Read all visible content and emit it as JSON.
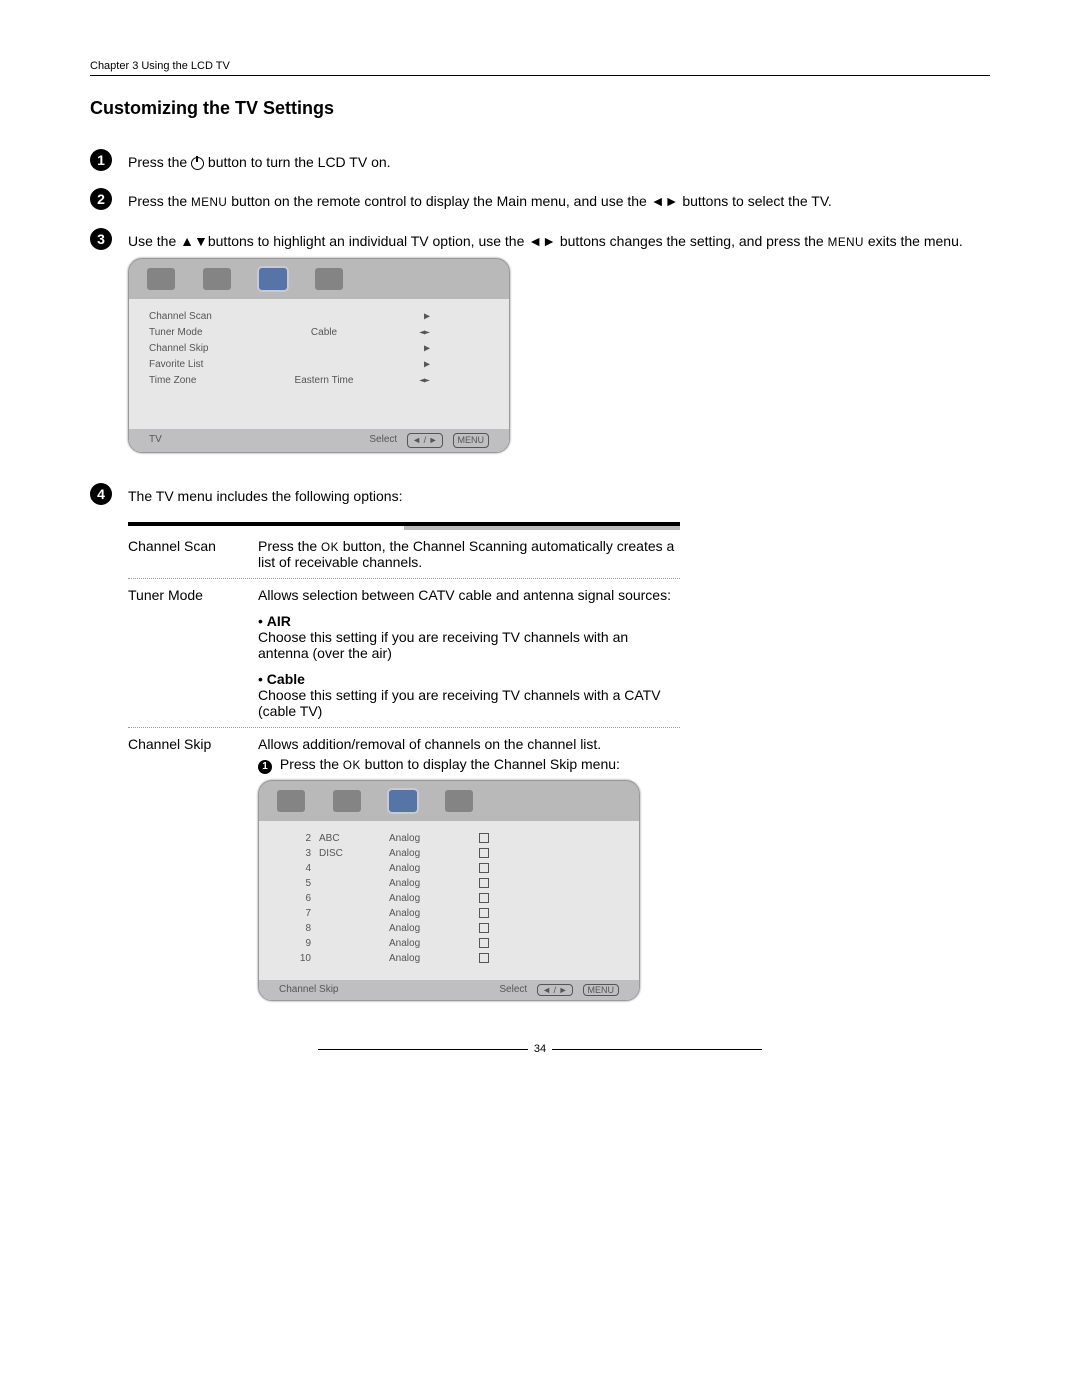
{
  "chapter": "Chapter 3 Using the LCD TV",
  "title": "Customizing the TV Settings",
  "steps": {
    "s1": {
      "n": "1",
      "pre": "Press the ",
      "post": " button to turn the LCD TV on."
    },
    "s2": {
      "n": "2",
      "a": "Press the ",
      "menu": "MENU",
      "b": " button on the remote control to display the Main menu, and use the ◄► buttons to select the TV."
    },
    "s3": {
      "n": "3",
      "a": "Use the ▲▼buttons to highlight an individual TV option, use the ◄► buttons changes the setting, and press the ",
      "menu": "MENU",
      "b": " exits the menu."
    },
    "s4": {
      "n": "4",
      "text": "The TV menu includes the following options:"
    }
  },
  "tv_menu": {
    "rows": [
      {
        "label": "Channel Scan",
        "value": "",
        "arr": "▶"
      },
      {
        "label": "Tuner Mode",
        "value": "Cable",
        "arr": "◄►"
      },
      {
        "label": "Channel Skip",
        "value": "",
        "arr": "▶"
      },
      {
        "label": "Favorite List",
        "value": "",
        "arr": "▶"
      },
      {
        "label": "Time Zone",
        "value": "Eastern Time",
        "arr": "◄►"
      }
    ],
    "foot_left": "TV",
    "foot_select": "Select",
    "foot_menu": "MENU"
  },
  "options": {
    "channel_scan": {
      "name": "Channel Scan",
      "desc_a": "Press the ",
      "ok": "OK",
      "desc_b": " button, the Channel Scanning automatically creates a list of receivable channels."
    },
    "tuner_mode": {
      "name": "Tuner Mode",
      "intro": "Allows selection between CATV cable and antenna signal sources:",
      "air_h": "AIR",
      "air_d": "Choose this setting if you are receiving TV channels with an antenna (over the air)",
      "cable_h": "Cable",
      "cable_d": "Choose this setting if you are receiving TV channels with a CATV (cable TV)"
    },
    "channel_skip": {
      "name": "Channel Skip",
      "intro": "Allows addition/removal of channels on the channel list.",
      "step1_n": "1",
      "step1_a": "Press the ",
      "ok": "OK",
      "step1_b": " button to display the Channel Skip menu:"
    }
  },
  "skip_menu": {
    "rows": [
      {
        "ch": "2",
        "nm": "ABC",
        "type": "Analog"
      },
      {
        "ch": "3",
        "nm": "DISC",
        "type": "Analog"
      },
      {
        "ch": "4",
        "nm": "",
        "type": "Analog"
      },
      {
        "ch": "5",
        "nm": "",
        "type": "Analog"
      },
      {
        "ch": "6",
        "nm": "",
        "type": "Analog"
      },
      {
        "ch": "7",
        "nm": "",
        "type": "Analog"
      },
      {
        "ch": "8",
        "nm": "",
        "type": "Analog"
      },
      {
        "ch": "9",
        "nm": "",
        "type": "Analog"
      },
      {
        "ch": "10",
        "nm": "",
        "type": "Analog"
      }
    ],
    "foot_left": "Channel Skip",
    "foot_select": "Select",
    "foot_menu": "MENU"
  },
  "page_num": "34"
}
